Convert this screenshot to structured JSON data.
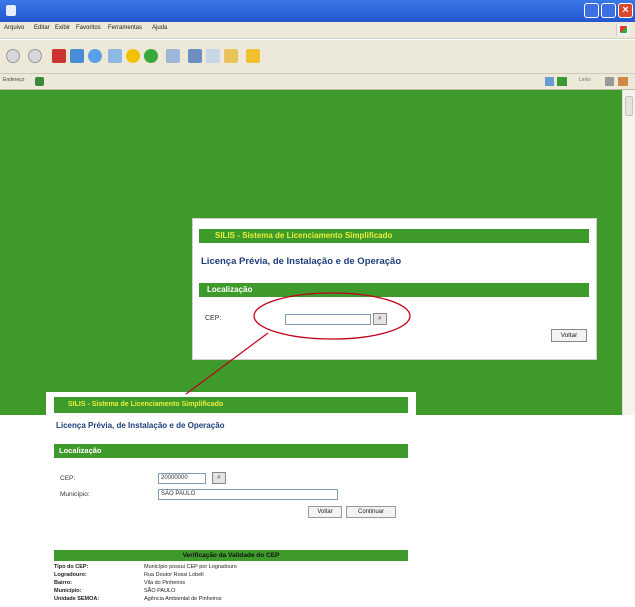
{
  "browser": {
    "menu": [
      "Arquivo",
      "Editar",
      "Exibir",
      "Favoritos",
      "Ferramentas",
      "Ajuda"
    ],
    "address_label": "Endereço",
    "links_label": "Links"
  },
  "dialog": {
    "header": "SILIS - Sistema de Licenciamento Simplificado",
    "title": "Licença Prévia, de Instalação e de Operação",
    "section": "Localização",
    "cep_label": "CEP:",
    "cep_value": "",
    "search_glyph": "⌕",
    "back_button": "Voltar"
  },
  "inset": {
    "header": "SILIS - Sistema de Licenciamento Simplificado",
    "title": "Licença Prévia, de Instalação e de Operação",
    "section": "Localização",
    "cep_label": "CEP:",
    "cep_value": "20000000",
    "search_glyph": "⌕",
    "municipio_label": "Município:",
    "municipio_value": "SÃO PAULO",
    "back_button": "Voltar",
    "continue_button": "Continuar",
    "verify_header": "Verificação da Validade do CEP",
    "verify_rows": [
      {
        "key": "Tipo do CEP:",
        "value": "Município possui CEP por Logradouro"
      },
      {
        "key": "Logradouro:",
        "value": "Rua Doutor Rossi Lobell"
      },
      {
        "key": "Bairro:",
        "value": "Vila do Pinheiros"
      },
      {
        "key": "Município:",
        "value": "SÃO PAULO"
      },
      {
        "key": "Unidade SEMOA:",
        "value": "Agência Ambiental de Pinheiros"
      }
    ]
  },
  "colors": {
    "green": "#3f9a2c",
    "header_text": "#e8f03a",
    "title_blue": "#1d3f7a",
    "callout_red": "#c0001a"
  }
}
